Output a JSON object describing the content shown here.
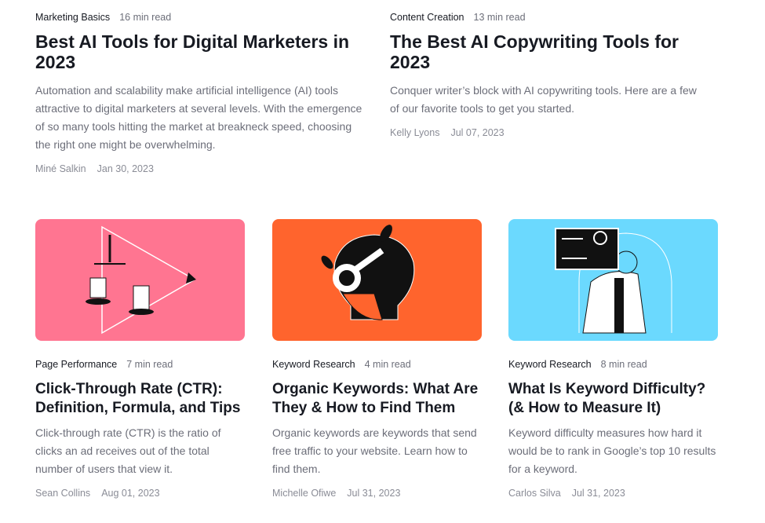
{
  "featured": [
    {
      "category": "Marketing Basics",
      "read_time": "16 min read",
      "title": "Best AI Tools for Digital Marketers in 2023",
      "excerpt": "Automation and scalability make artificial intelligence (AI) tools attractive to digital marketers at several levels. With the emergence of so many tools hitting the market at breakneck speed, choosing the right one might be overwhelming.",
      "author": "Miné Salkin",
      "date": "Jan 30, 2023"
    },
    {
      "category": "Content Creation",
      "read_time": "13 min read",
      "title": "The Best AI Copywriting Tools for 2023",
      "excerpt": "Conquer writer’s block with AI copywriting tools. Here are a few of our favorite tools to get you started.",
      "author": "Kelly Lyons",
      "date": "Jul 07, 2023"
    }
  ],
  "cards": [
    {
      "category": "Page Performance",
      "read_time": "7 min read",
      "title": "Click-Through Rate (CTR): Definition, Formula, and Tips",
      "excerpt": "Click-through rate (CTR) is the ratio of clicks an ad receives out of the total number of users that view it.",
      "author": "Sean Collins",
      "date": "Aug 01, 2023",
      "image_color": "#ff7591",
      "illustration": "scales-play-icon"
    },
    {
      "category": "Keyword Research",
      "read_time": "4 min read",
      "title": "Organic Keywords: What Are They & How to Find Them",
      "excerpt": "Organic keywords are keywords that send free traffic to your website. Learn how to find them.",
      "author": "Michelle Ofiwe",
      "date": "Jul 31, 2023",
      "image_color": "#ff642d",
      "illustration": "hand-key-icon"
    },
    {
      "category": "Keyword Research",
      "read_time": "8 min read",
      "title": "What Is Keyword Difficulty? (& How to Measure It)",
      "excerpt": "Keyword difficulty measures how hard it would be to rank in Google’s top 10 results for a keyword.",
      "author": "Carlos Silva",
      "date": "Jul 31, 2023",
      "image_color": "#6bd9fe",
      "illustration": "doctor-xray-icon"
    }
  ]
}
